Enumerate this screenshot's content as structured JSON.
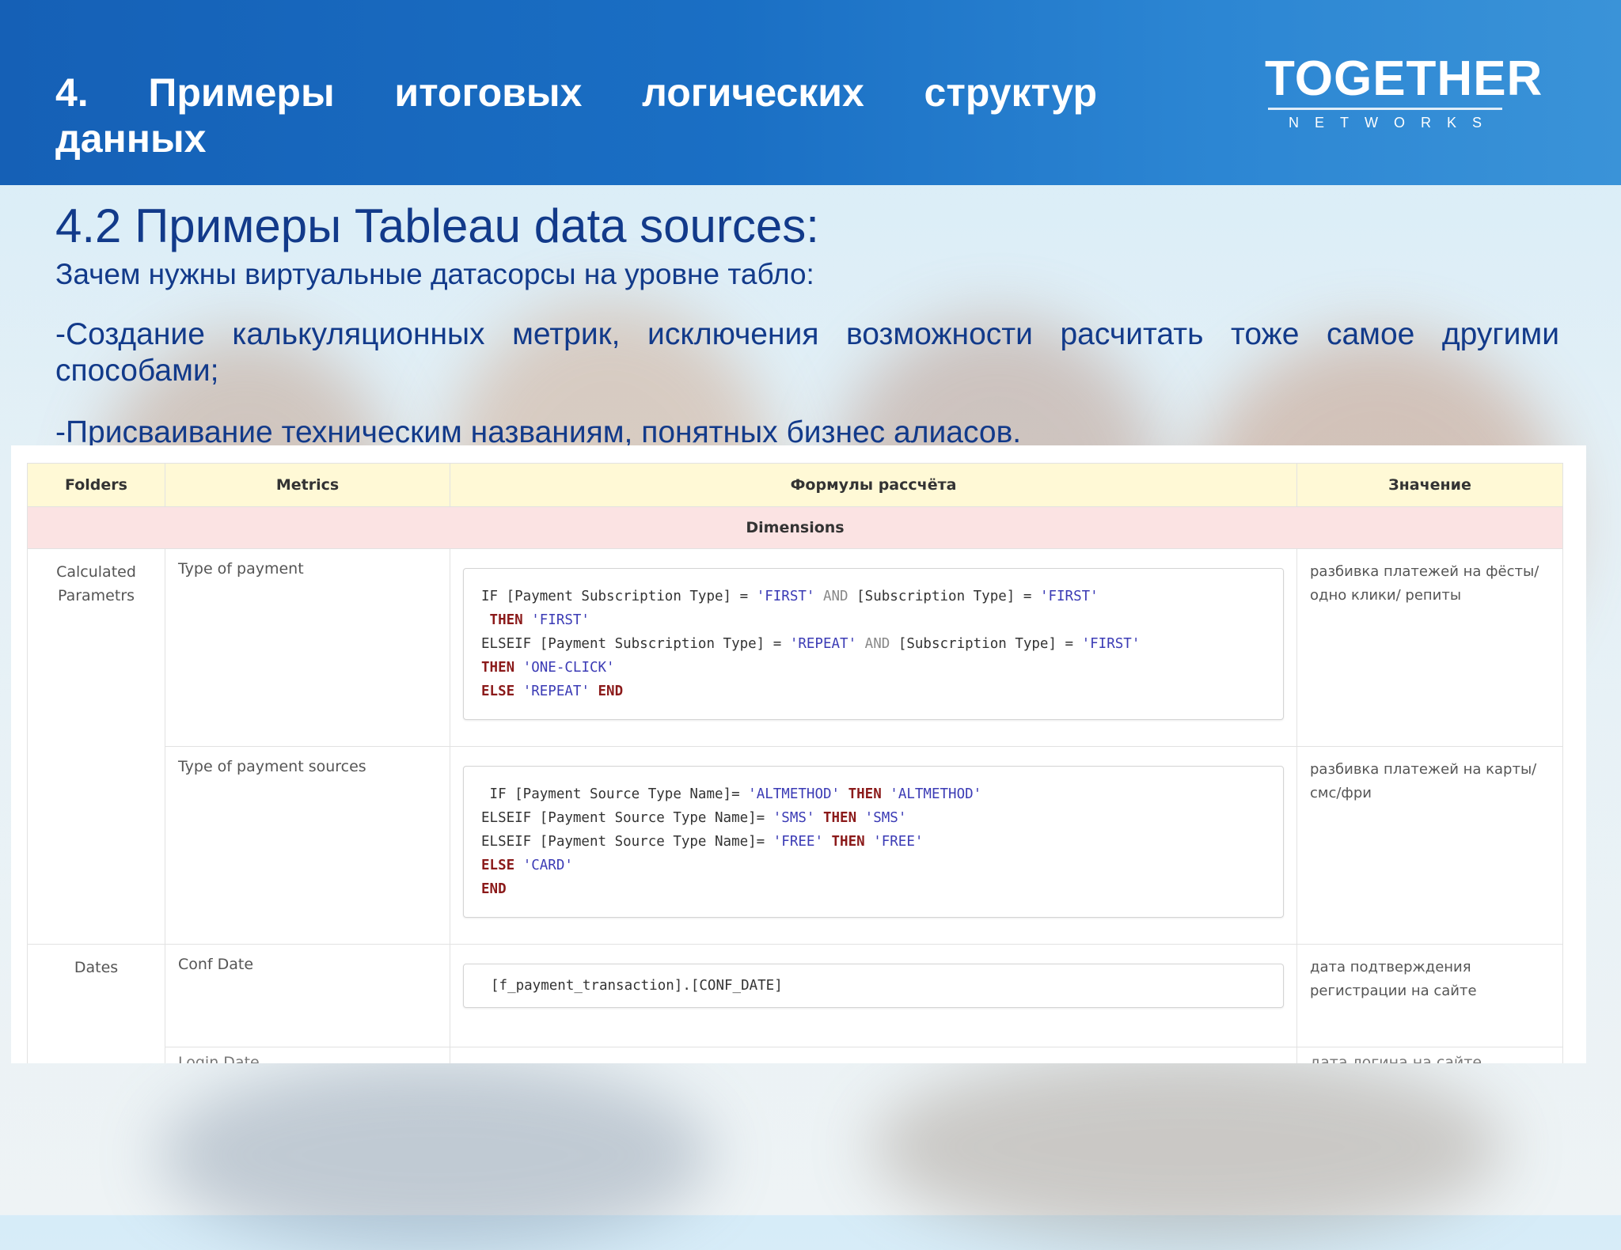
{
  "header": {
    "title_words": [
      "4.",
      "Примеры",
      "итоговых",
      "логических",
      "структур"
    ],
    "title_line2": "данных",
    "logo_main": "TOGETHER",
    "logo_sub": "NETWORKS"
  },
  "slide": {
    "title": "4.2 Примеры Tableau data sources:",
    "subtitle": "Зачем нужны виртуальные датасорсы на уровне табло:",
    "bullet1": "-Создание калькуляционных метрик, исключения возможности расчитать тоже самое другими способами;",
    "bullet2": "-Присваивание техническим названиям, понятных бизнес алиасов."
  },
  "table": {
    "headers": [
      "Folders",
      "Metrics",
      "Формулы рассчёта",
      "Значение"
    ],
    "section": "Dimensions",
    "rows": [
      {
        "folder": "Calculated Parametrs",
        "metric": "Type of payment",
        "value": "разбивка платежей на фёсты/ одно клики/ репиты"
      },
      {
        "folder": "",
        "metric": "Type of payment sources",
        "value": "разбивка платежей на карты/ смс/фри"
      },
      {
        "folder": "Dates",
        "metric": "Conf Date",
        "formula": "[f_payment_transaction].[CONF_DATE]",
        "value": "дата подтверждения регистрации на сайте"
      }
    ],
    "cutoff_metric": "Login Date",
    "cutoff_value": "дата логина на сайте"
  },
  "formula1": {
    "l1a": "IF [Payment Subscription Type] = ",
    "l1s1": "'FIRST'",
    "l1and": " AND ",
    "l1b": "[Subscription Type] = ",
    "l1s2": "'FIRST'",
    "l2k": " THEN ",
    "l2s": "'FIRST'",
    "l3a": "ELSEIF [Payment Subscription Type] = ",
    "l3s1": "'REPEAT'",
    "l3and": " AND ",
    "l3b": "[Subscription Type] = ",
    "l3s2": "'FIRST'",
    "l4k": "THEN ",
    "l4s": "'ONE-CLICK'",
    "l5k": "ELSE ",
    "l5s": "'REPEAT'",
    "l5e": " END"
  },
  "formula2": {
    "l1a": " IF [Payment Source Type Name]= ",
    "l1s1": "'ALTMETHOD'",
    "l1k": " THEN ",
    "l1s2": "'ALTMETHOD'",
    "l2a": "ELSEIF [Payment Source Type Name]= ",
    "l2s1": "'SMS'",
    "l2k": " THEN ",
    "l2s2": "'SMS'",
    "l3a": "ELSEIF [Payment Source Type Name]= ",
    "l3s1": "'FREE'",
    "l3k": " THEN ",
    "l3s2": "'FREE'",
    "l4k": "ELSE ",
    "l4s": "'CARD'",
    "l5k": "END"
  }
}
